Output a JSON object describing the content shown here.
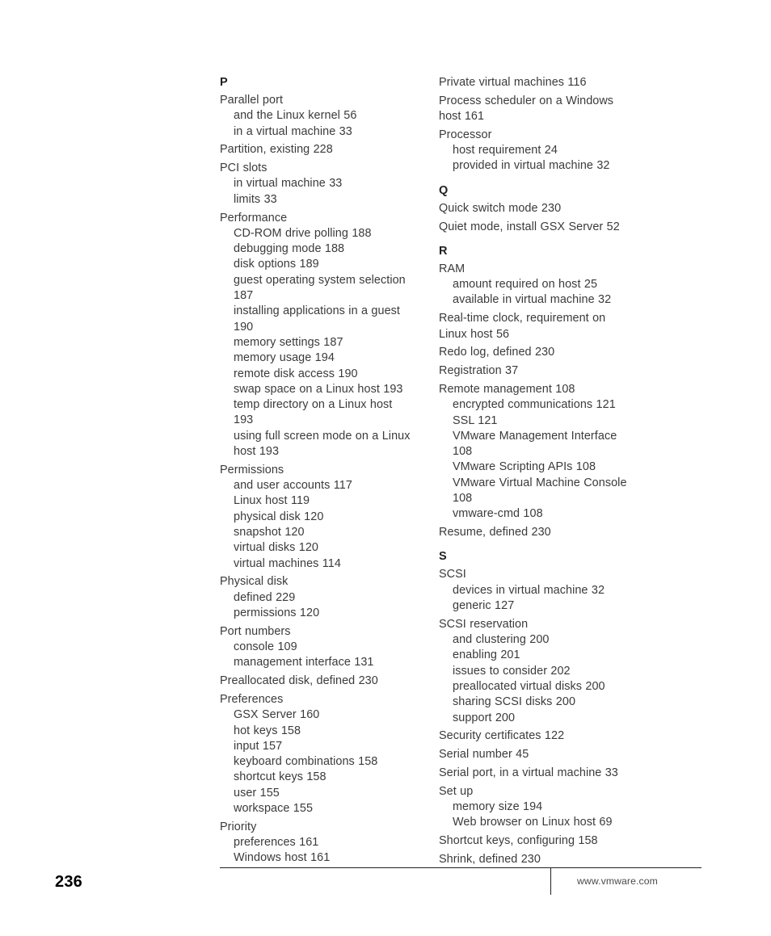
{
  "document": {
    "page_number": "236",
    "footer_url": "www.vmware.com"
  },
  "index": {
    "columns": [
      {
        "id": "left",
        "sections": [
          {
            "letter": "P",
            "groups": [
              {
                "entry": "Parallel port",
                "subentries": [
                  "and the Linux kernel 56",
                  "in a virtual machine 33"
                ]
              },
              {
                "entry": "Partition, existing 228",
                "subentries": []
              },
              {
                "entry": "PCI slots",
                "subentries": [
                  "in virtual machine 33",
                  "limits 33"
                ]
              },
              {
                "entry": "Performance",
                "subentries": [
                  "CD-ROM drive polling 188",
                  "debugging mode 188",
                  "disk options 189",
                  "guest operating system selection 187",
                  "installing applications in a guest 190",
                  "memory settings 187",
                  "memory usage 194",
                  "remote disk access 190",
                  "swap space on a Linux host 193",
                  "temp directory on a Linux host 193",
                  "using full screen mode on a Linux host 193"
                ]
              },
              {
                "entry": "Permissions",
                "subentries": [
                  "and user accounts 117",
                  "Linux host 119",
                  "physical disk 120",
                  "snapshot 120",
                  "virtual disks 120",
                  "virtual machines 114"
                ]
              },
              {
                "entry": "Physical disk",
                "subentries": [
                  "defined 229",
                  "permissions 120"
                ]
              },
              {
                "entry": "Port numbers",
                "subentries": [
                  "console 109",
                  "management interface 131"
                ]
              },
              {
                "entry": "Preallocated disk, defined 230",
                "subentries": []
              },
              {
                "entry": "Preferences",
                "subentries": [
                  "GSX Server 160",
                  "hot keys 158",
                  "input 157",
                  "keyboard combinations 158",
                  "shortcut keys 158",
                  "user 155",
                  "workspace 155"
                ]
              },
              {
                "entry": "Priority",
                "subentries": [
                  "preferences 161",
                  "Windows host 161"
                ]
              }
            ]
          }
        ]
      },
      {
        "id": "right",
        "sections": [
          {
            "letter": null,
            "groups": [
              {
                "entry": "Private virtual machines 116",
                "subentries": []
              },
              {
                "entry": "Process scheduler on a Windows host 161",
                "subentries": []
              },
              {
                "entry": "Processor",
                "subentries": [
                  "host requirement 24",
                  "provided in virtual machine 32"
                ]
              }
            ]
          },
          {
            "letter": "Q",
            "groups": [
              {
                "entry": "Quick switch mode 230",
                "subentries": []
              },
              {
                "entry": "Quiet mode, install GSX Server 52",
                "subentries": []
              }
            ]
          },
          {
            "letter": "R",
            "groups": [
              {
                "entry": "RAM",
                "subentries": [
                  "amount required on host 25",
                  "available in virtual machine 32"
                ]
              },
              {
                "entry": "Real-time clock, requirement on Linux host 56",
                "subentries": []
              },
              {
                "entry": "Redo log, defined 230",
                "subentries": []
              },
              {
                "entry": "Registration 37",
                "subentries": []
              },
              {
                "entry": "Remote management 108",
                "subentries": [
                  "encrypted communications 121",
                  "SSL 121",
                  "VMware Management Interface 108",
                  "VMware Scripting APIs 108",
                  "VMware Virtual Machine Console 108",
                  "vmware-cmd 108"
                ]
              },
              {
                "entry": "Resume, defined 230",
                "subentries": []
              }
            ]
          },
          {
            "letter": "S",
            "groups": [
              {
                "entry": "SCSI",
                "subentries": [
                  "devices in virtual machine 32",
                  "generic 127"
                ]
              },
              {
                "entry": "SCSI reservation",
                "subentries": [
                  "and clustering 200",
                  "enabling 201",
                  "issues to consider 202",
                  "preallocated virtual disks 200",
                  "sharing SCSI disks 200",
                  "support 200"
                ]
              },
              {
                "entry": "Security certificates 122",
                "subentries": []
              },
              {
                "entry": "Serial number 45",
                "subentries": []
              },
              {
                "entry": "Serial port, in a virtual machine 33",
                "subentries": []
              },
              {
                "entry": "Set up",
                "subentries": [
                  "memory size 194",
                  "Web browser on Linux host 69"
                ]
              },
              {
                "entry": "Shortcut keys, configuring 158",
                "subentries": []
              },
              {
                "entry": "Shrink, defined 230",
                "subentries": []
              }
            ]
          }
        ]
      }
    ]
  }
}
